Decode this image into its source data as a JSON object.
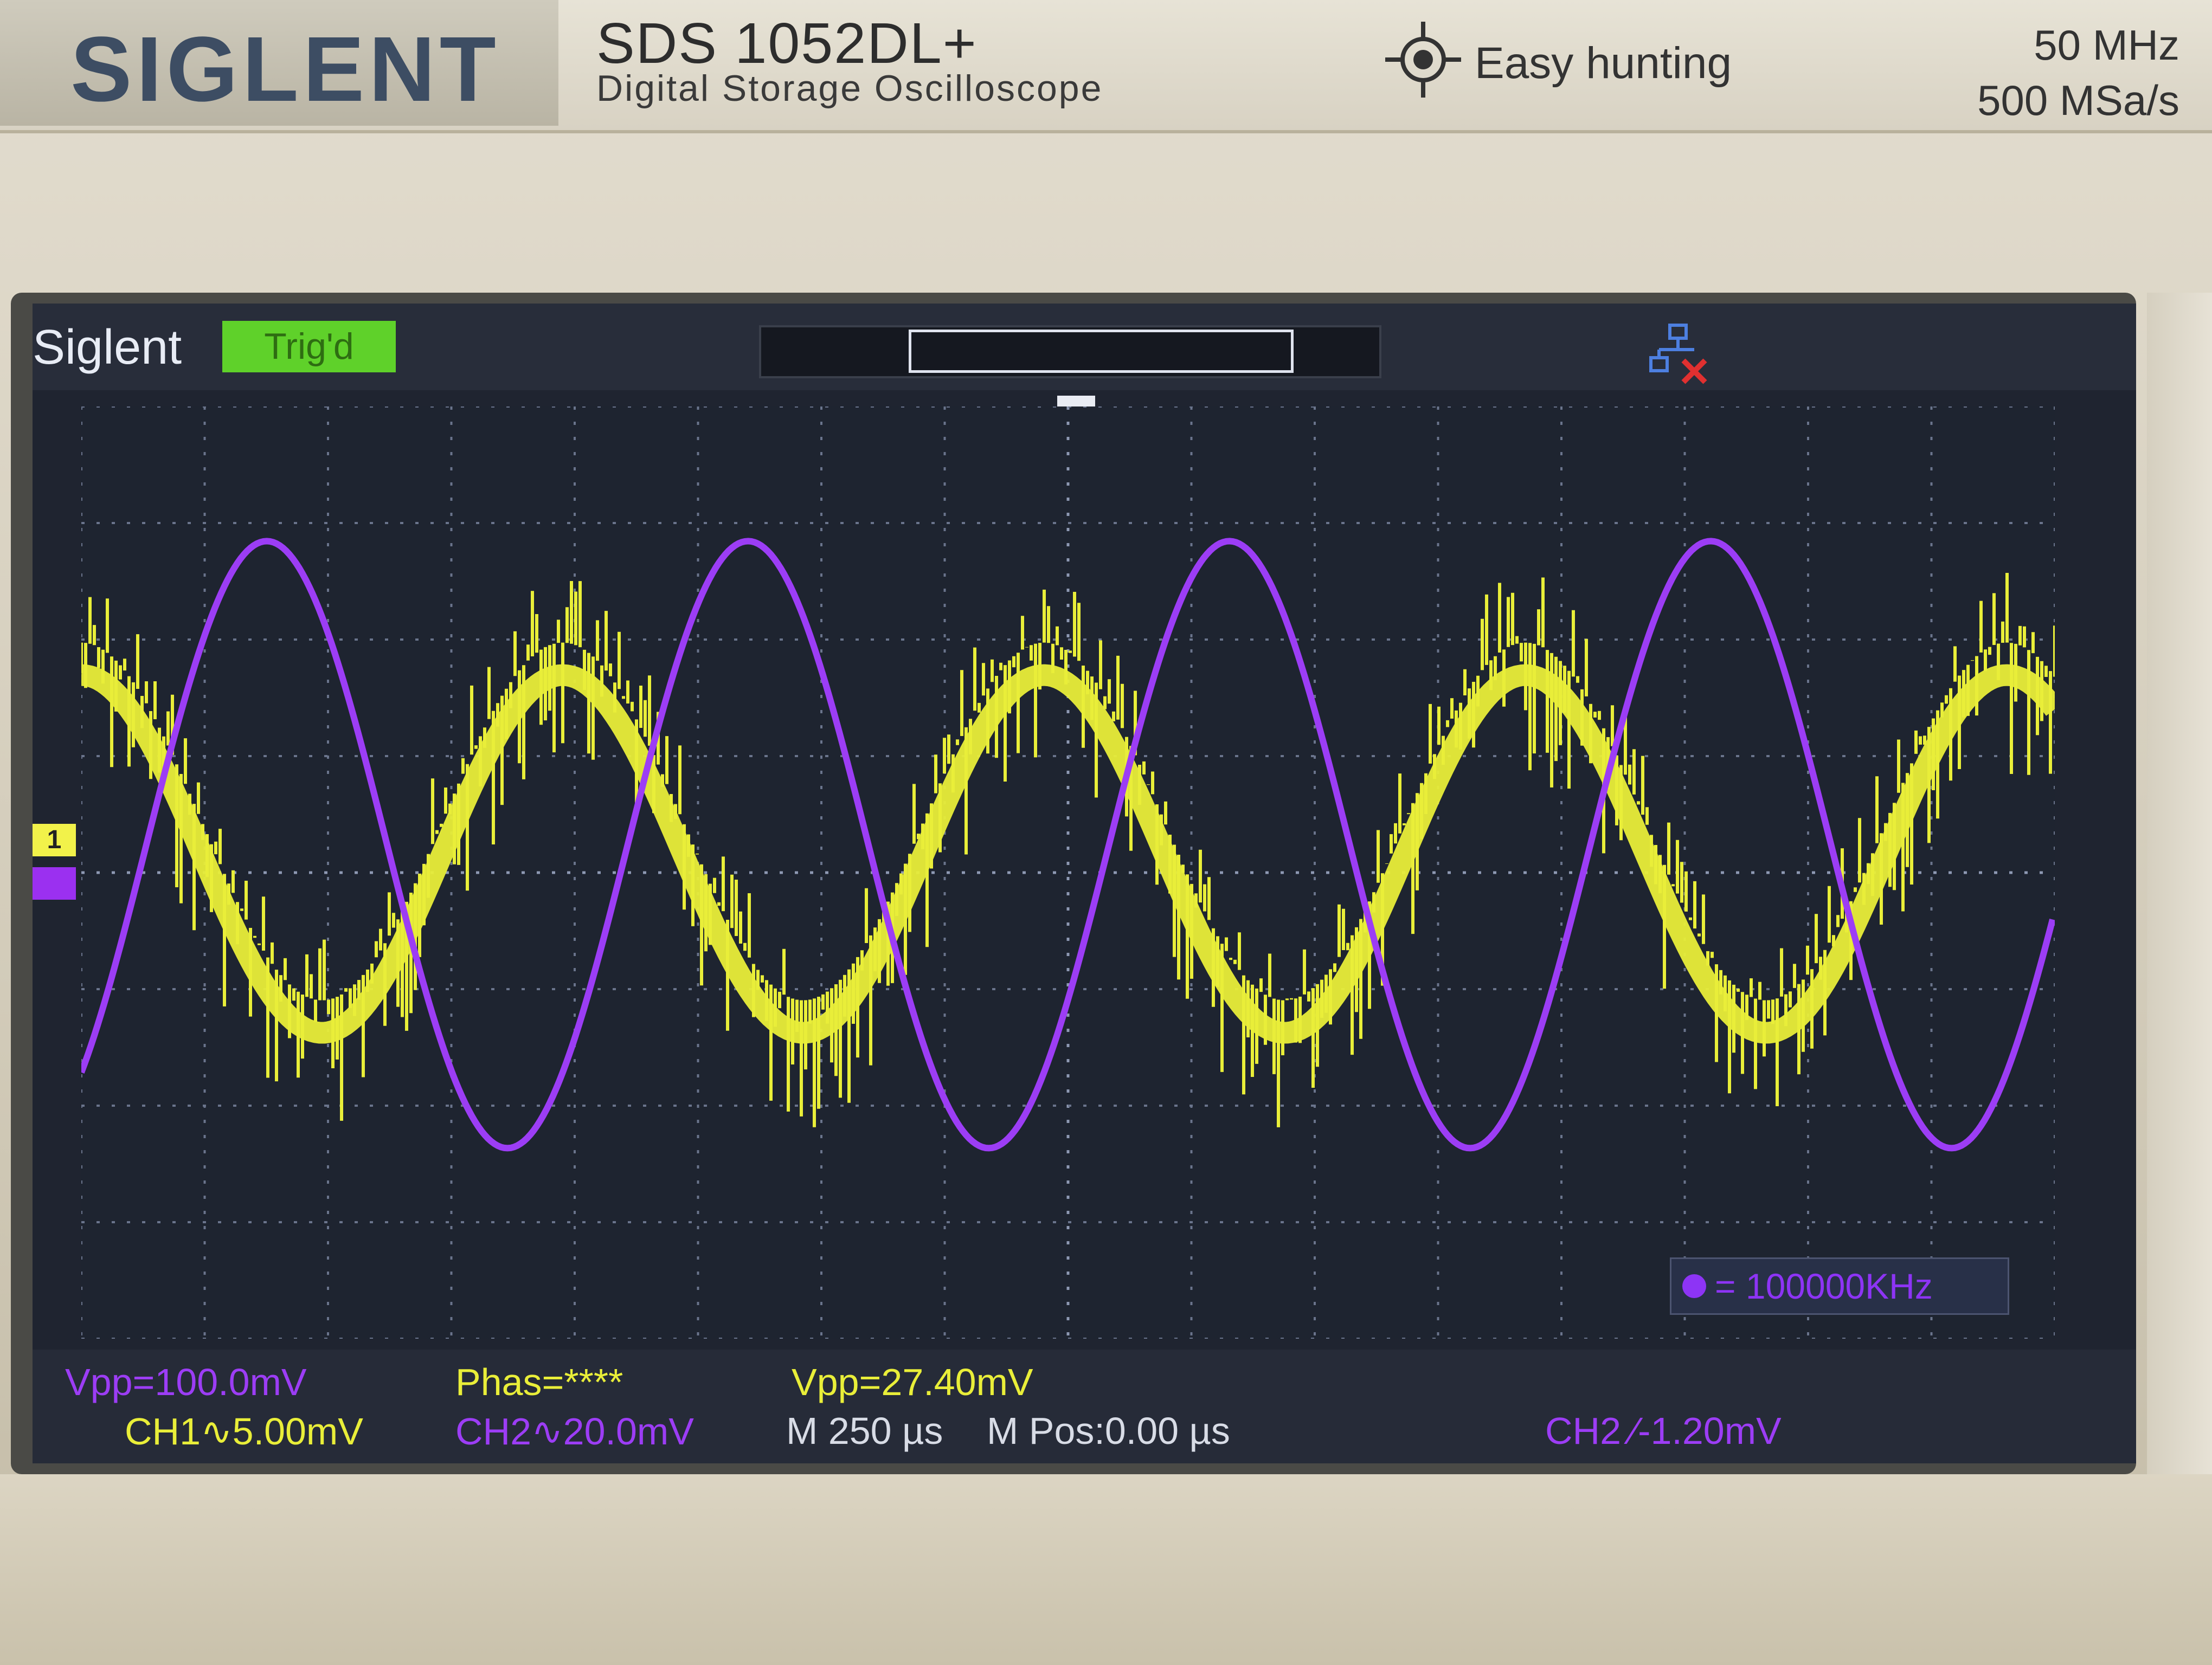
{
  "device": {
    "brand_logo": "SIGLENT",
    "model": "SDS 1052DL+",
    "model_subtitle": "Digital Storage Oscilloscope",
    "feature_label": "Easy hunting",
    "bandwidth": "50 MHz",
    "sample_rate": "500 MSa/s"
  },
  "screen": {
    "brand": "Siglent",
    "trigger_status": "Trig'd",
    "trigger_position_label": "T",
    "channel_marker_1": "1",
    "frequency_readout": "= 100000KHz"
  },
  "measurements": {
    "ch2_vpp": "Vpp=100.0mV",
    "phase": "Phas=****",
    "ch1_vpp": "Vpp=27.40mV",
    "ch1_scale": "CH1∿5.00mV",
    "ch2_scale": "CH2∿20.0mV",
    "timebase": "M 250 µs",
    "time_position": "M Pos:0.00 µs",
    "trigger_setting": "CH2 ∕-1.20mV"
  },
  "colors": {
    "ch1": "#e9ee39",
    "ch2": "#9c3df5",
    "trig_badge": "#5fd12a"
  },
  "icons": [
    "crosshair-icon",
    "lan-disconnected-icon"
  ]
}
